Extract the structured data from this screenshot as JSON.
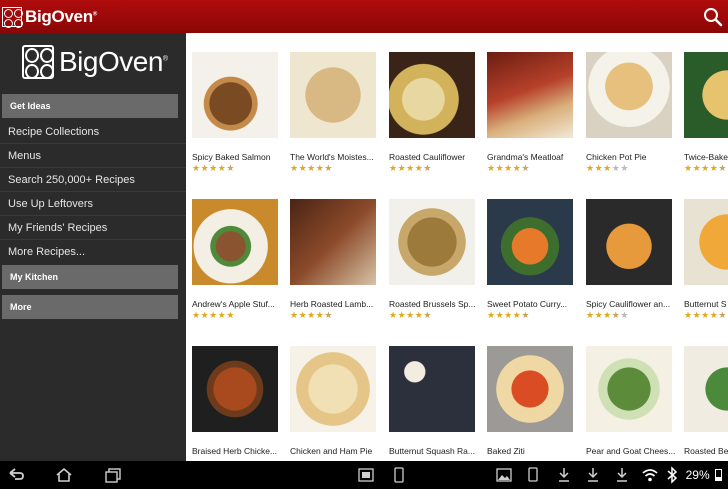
{
  "app": {
    "brand": "BigOven",
    "accent": "#a00a0a"
  },
  "sidebar": {
    "logo_text": "BigOven",
    "sections": [
      {
        "header": "Get Ideas",
        "items": [
          {
            "label": "Recipe Collections"
          },
          {
            "label": "Menus"
          },
          {
            "label": "Search 250,000+ Recipes"
          },
          {
            "label": "Use Up Leftovers"
          },
          {
            "label": "My Friends' Recipes"
          },
          {
            "label": "More Recipes..."
          }
        ]
      },
      {
        "header": "My Kitchen",
        "items": []
      },
      {
        "header": "More",
        "items": []
      }
    ]
  },
  "recipes": [
    {
      "title": "Spicy Baked Salmon",
      "rating": 4.5
    },
    {
      "title": "The World's Moistes...",
      "rating": 4.5
    },
    {
      "title": "Roasted Cauliflower",
      "rating": 4.5
    },
    {
      "title": "Grandma's Meatloaf",
      "rating": 4.5
    },
    {
      "title": "Chicken Pot Pie",
      "rating": 3
    },
    {
      "title": "Twice-Bake",
      "rating": 4.5
    },
    {
      "title": "Andrew's Apple Stuf...",
      "rating": 5
    },
    {
      "title": "Herb Roasted Lamb...",
      "rating": 4.5
    },
    {
      "title": "Roasted Brussels Sp...",
      "rating": 4.5
    },
    {
      "title": "Sweet Potato Curry...",
      "rating": 4.5
    },
    {
      "title": "Spicy Cauliflower an...",
      "rating": 3.5
    },
    {
      "title": "Butternut S",
      "rating": 4.5
    },
    {
      "title": "Braised Herb Chicke...",
      "rating": null
    },
    {
      "title": "Chicken and Ham Pie",
      "rating": null
    },
    {
      "title": "Butternut Squash Ra...",
      "rating": null
    },
    {
      "title": "Baked Ziti",
      "rating": null
    },
    {
      "title": "Pear and Goat Chees...",
      "rating": null
    },
    {
      "title": "Roasted Be",
      "rating": null
    }
  ],
  "status_bar": {
    "battery": "29%"
  }
}
